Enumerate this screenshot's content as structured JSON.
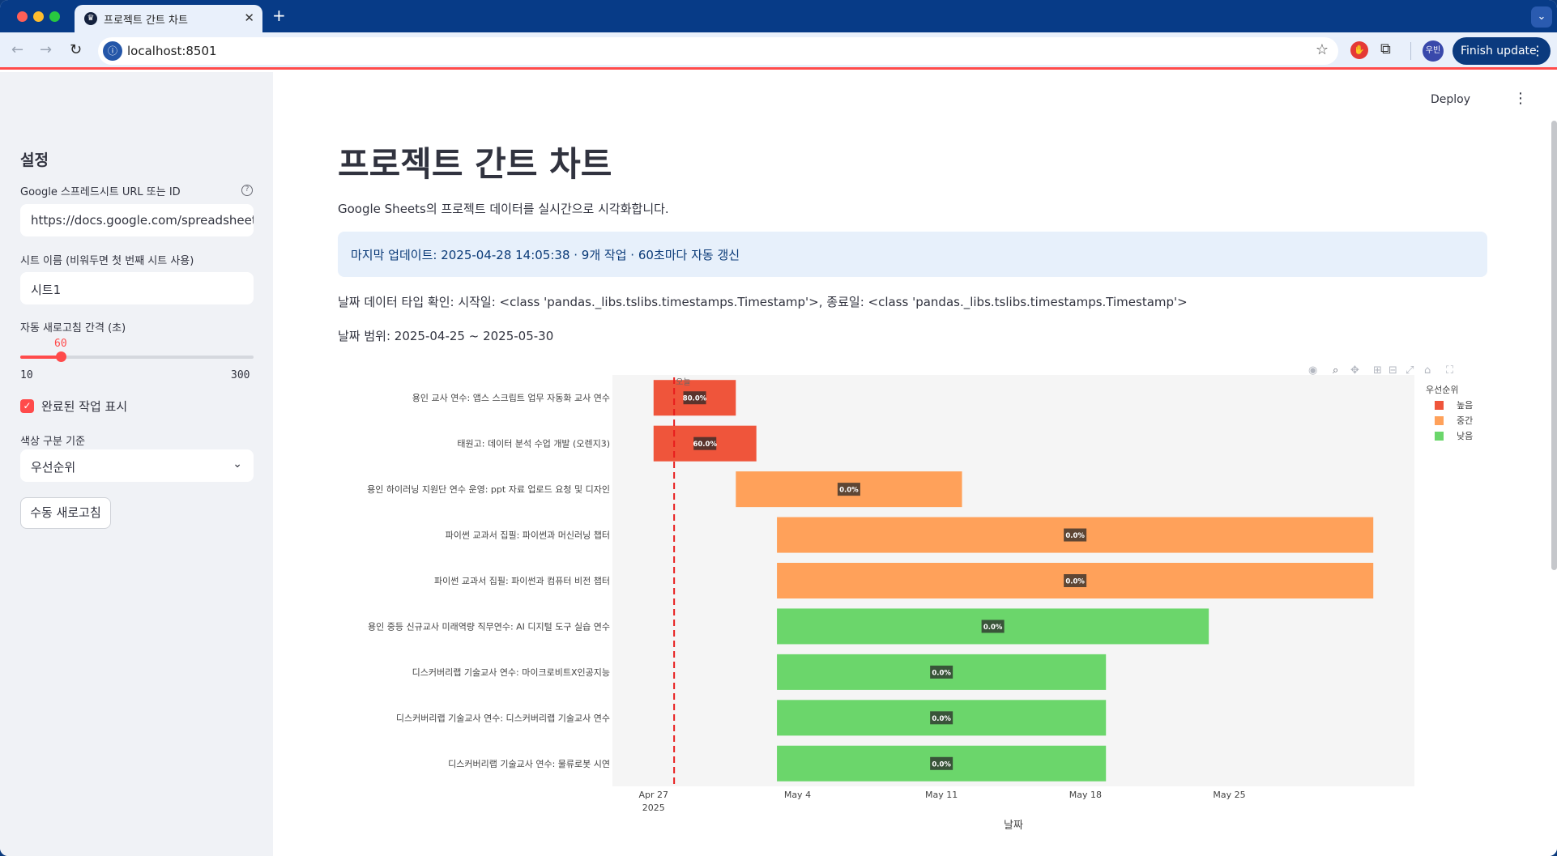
{
  "browser": {
    "tab_title": "프로젝트 간트 차트",
    "url": "localhost:8501",
    "profile_label": "우빈",
    "finish_update": "Finish update"
  },
  "sidebar": {
    "title": "설정",
    "sheet_url_label": "Google 스프레드시트 URL 또는 ID",
    "sheet_url_value": "https://docs.google.com/spreadsheets/d/",
    "sheet_name_label": "시트 이름 (비워두면 첫 번째 시트 사용)",
    "sheet_name_value": "시트1",
    "refresh_interval_label": "자동 새로고침 간격 (초)",
    "refresh_interval": {
      "value": "60",
      "min": "10",
      "max": "300",
      "fraction": 0.172
    },
    "show_completed_label": "완료된 작업 표시",
    "show_completed_checked": true,
    "color_by_label": "색상 구분 기준",
    "color_by_value": "우선순위",
    "manual_refresh_label": "수동 새로고침"
  },
  "header": {
    "deploy": "Deploy"
  },
  "main": {
    "title": "프로젝트 간트 차트",
    "caption": "Google Sheets의 프로젝트 데이터를 실시간으로 시각화합니다.",
    "info": "마지막 업데이트: 2025-04-28 14:05:38 · 9개 작업 · 60초마다 자동 갱신",
    "dtype_line": "날짜 데이터 타입 확인: 시작일: <class 'pandas._libs.tslibs.timestamps.Timestamp'>, 종료일: <class 'pandas._libs.tslibs.timestamps.Timestamp'>",
    "range_line": "날짜 범위: 2025-04-25 ~ 2025-05-30"
  },
  "chart_data": {
    "type": "gantt",
    "xlabel": "날짜",
    "x_range": [
      "2025-04-25",
      "2025-06-03"
    ],
    "x_ticks": [
      {
        "date": "2025-04-27",
        "label": "Apr 27",
        "sub": "2025"
      },
      {
        "date": "2025-05-04",
        "label": "May 4",
        "sub": ""
      },
      {
        "date": "2025-05-11",
        "label": "May 11",
        "sub": ""
      },
      {
        "date": "2025-05-18",
        "label": "May 18",
        "sub": ""
      },
      {
        "date": "2025-05-25",
        "label": "May 25",
        "sub": ""
      }
    ],
    "today": {
      "date": "2025-04-28",
      "label": "오늘"
    },
    "legend_title": "우선순위",
    "legend_position": "top-right",
    "legend": [
      {
        "name": "높음",
        "color": "#ef553b"
      },
      {
        "name": "중간",
        "color": "#ffa15a"
      },
      {
        "name": "낮음",
        "color": "#6bd66b"
      }
    ],
    "tasks": [
      {
        "name": "용인 교사 연수: 앱스 스크립트 업무 자동화 교사 연수",
        "start": "2025-04-27",
        "end": "2025-05-01",
        "priority": "높음",
        "progress": "80.0%"
      },
      {
        "name": "태원고: 데이터 분석 수업 개발 (오렌지3)",
        "start": "2025-04-27",
        "end": "2025-05-02",
        "priority": "높음",
        "progress": "60.0%"
      },
      {
        "name": "용인 하이러닝 지원단 연수 운영: ppt 자료 업로드 요청 및 디자인",
        "start": "2025-05-01",
        "end": "2025-05-12",
        "priority": "중간",
        "progress": "0.0%"
      },
      {
        "name": "파이썬 교과서 집필: 파이썬과 머신러닝 챕터",
        "start": "2025-05-03",
        "end": "2025-06-01",
        "priority": "중간",
        "progress": "0.0%"
      },
      {
        "name": "파이썬 교과서 집필: 파이썬과 컴퓨터 비전 챕터",
        "start": "2025-05-03",
        "end": "2025-06-01",
        "priority": "중간",
        "progress": "0.0%"
      },
      {
        "name": "용인 중등 신규교사 미래역량 직무연수: AI 디지털 도구 실습 연수",
        "start": "2025-05-03",
        "end": "2025-05-24",
        "priority": "낮음",
        "progress": "0.0%"
      },
      {
        "name": "디스커버리랩 기술교사 연수: 마이크로비트X인공지능",
        "start": "2025-05-03",
        "end": "2025-05-19",
        "priority": "낮음",
        "progress": "0.0%"
      },
      {
        "name": "디스커버리랩 기술교사 연수: 디스커버리랩 기술교사 연수",
        "start": "2025-05-03",
        "end": "2025-05-19",
        "priority": "낮음",
        "progress": "0.0%"
      },
      {
        "name": "디스커버리랩 기술교사 연수: 물류로봇 시연",
        "start": "2025-05-03",
        "end": "2025-05-19",
        "priority": "낮음",
        "progress": "0.0%"
      }
    ]
  }
}
